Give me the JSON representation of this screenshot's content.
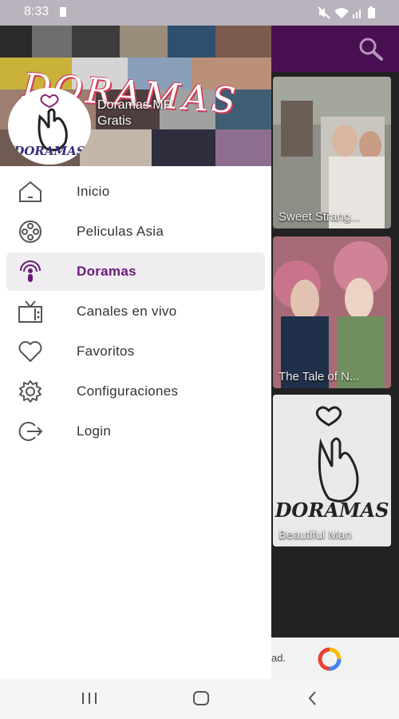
{
  "status": {
    "time": "8:33"
  },
  "drawer": {
    "brand_line1": "Doramas MP",
    "brand_line2": "Gratis",
    "logo_text": "DORAMAS",
    "header_title": "DORAMAS",
    "items": [
      {
        "label": "Inicio",
        "icon": "home-icon",
        "active": false
      },
      {
        "label": "Peliculas Asia",
        "icon": "film-reel-icon",
        "active": false
      },
      {
        "label": "Doramas",
        "icon": "podcast-icon",
        "active": true
      },
      {
        "label": "Canales en vivo",
        "icon": "tv-icon",
        "active": false
      },
      {
        "label": "Favoritos",
        "icon": "heart-icon",
        "active": false
      },
      {
        "label": "Configuraciones",
        "icon": "gear-icon",
        "active": false
      },
      {
        "label": "Login",
        "icon": "login-icon",
        "active": false
      }
    ]
  },
  "main": {
    "cards": [
      {
        "title": "Sweet Strang..."
      },
      {
        "title": "The Tale of N..."
      },
      {
        "title": "Beautiful Man",
        "logo_text": "DORAMAS"
      }
    ],
    "ad_text": "ad."
  },
  "colors": {
    "accent": "#6a1b77",
    "appbar": "#4a0f52"
  }
}
